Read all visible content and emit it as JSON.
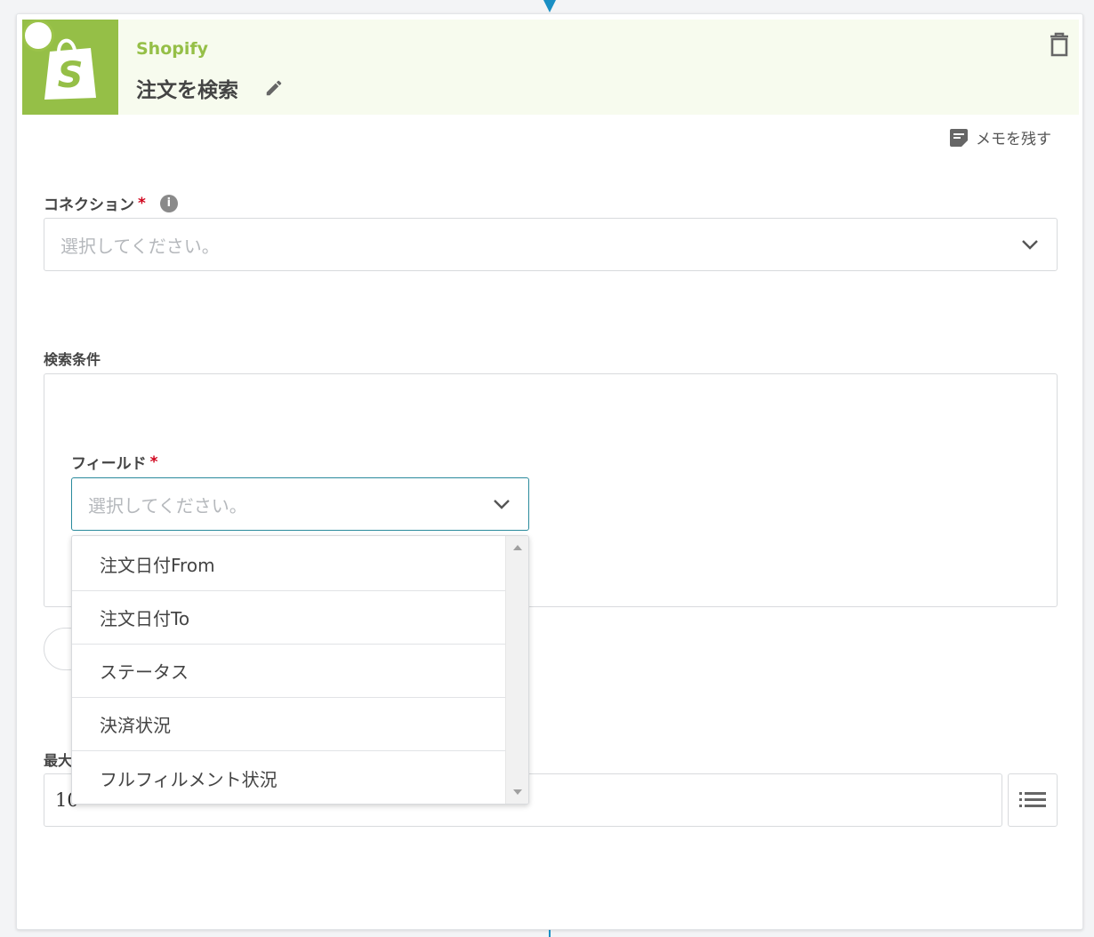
{
  "header": {
    "app_name": "Shopify",
    "action_title": "注文を検索",
    "brand_color": "#95bf47",
    "logo_letter": "S"
  },
  "memo": {
    "label": "メモを残す"
  },
  "connection": {
    "label": "コネクション",
    "required_mark": "*",
    "info_icon_glyph": "i",
    "placeholder": "選択してください。"
  },
  "conditions": {
    "label": "検索条件",
    "field": {
      "label": "フィールド",
      "required_mark": "*",
      "placeholder": "選択してください。",
      "options": [
        "注文日付From",
        "注文日付To",
        "ステータス",
        "決済状況",
        "フルフィルメント状況"
      ]
    }
  },
  "max_count": {
    "label": "最大",
    "value": "10"
  },
  "icons": {
    "trash": "trash-icon",
    "edit": "pencil-icon",
    "memo": "note-icon",
    "info": "info-icon",
    "chevron": "chevron-down-icon",
    "list": "list-icon"
  }
}
